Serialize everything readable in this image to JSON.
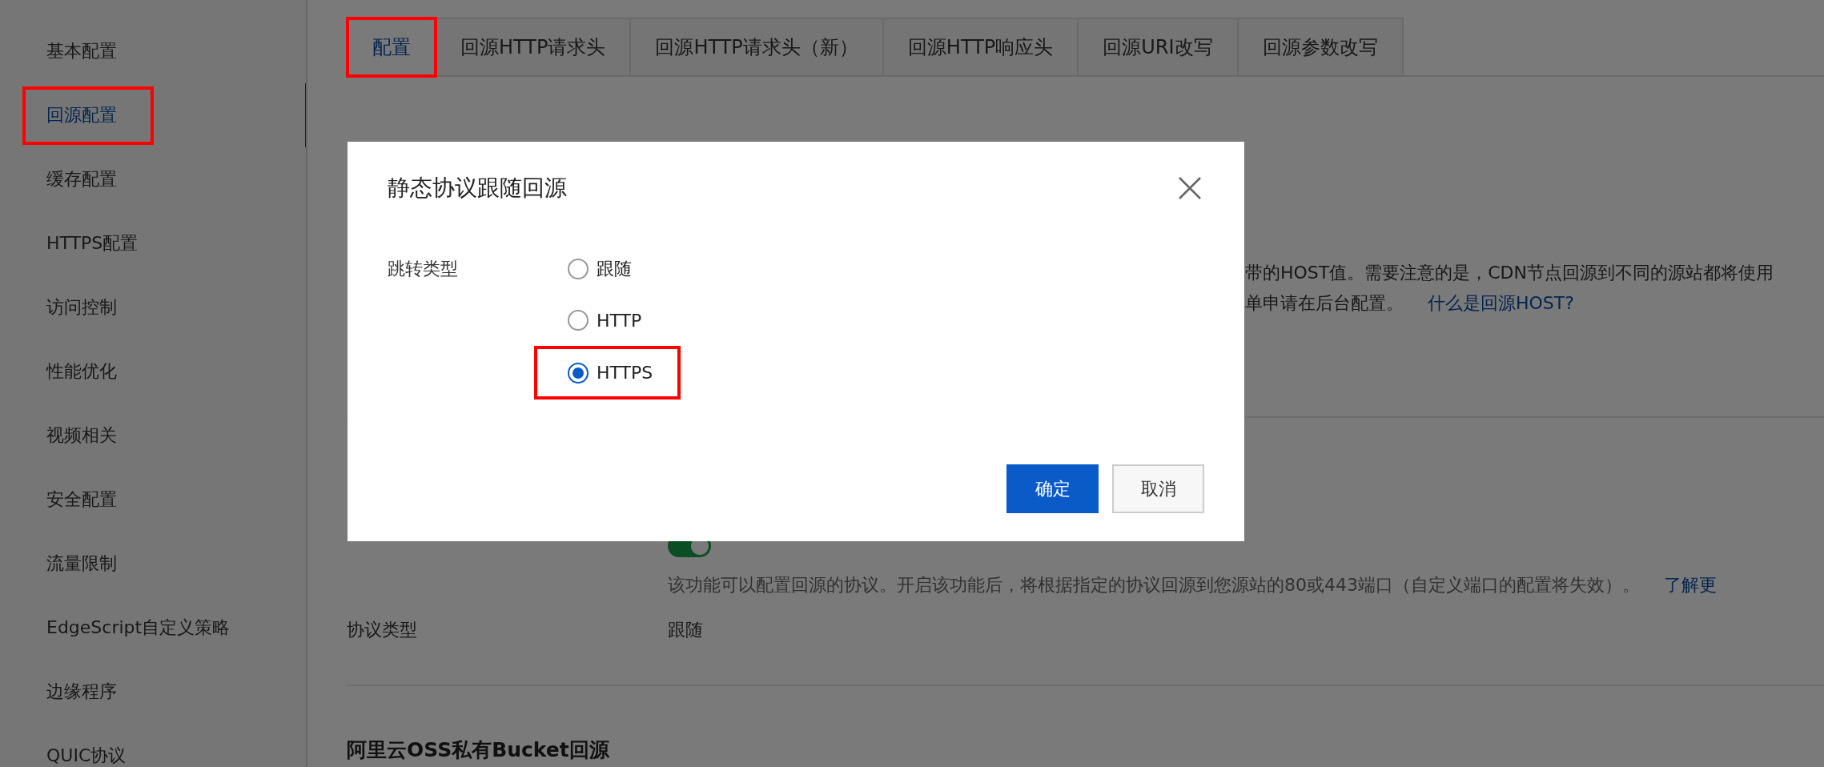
{
  "sidebar": {
    "items": [
      {
        "label": "基本配置",
        "selected": false,
        "highlighted": false
      },
      {
        "label": "回源配置",
        "selected": true,
        "highlighted": true
      },
      {
        "label": "缓存配置",
        "selected": false,
        "highlighted": false
      },
      {
        "label": "HTTPS配置",
        "selected": false,
        "highlighted": false
      },
      {
        "label": "访问控制",
        "selected": false,
        "highlighted": false
      },
      {
        "label": "性能优化",
        "selected": false,
        "highlighted": false
      },
      {
        "label": "视频相关",
        "selected": false,
        "highlighted": false
      },
      {
        "label": "安全配置",
        "selected": false,
        "highlighted": false
      },
      {
        "label": "流量限制",
        "selected": false,
        "highlighted": false
      },
      {
        "label": "EdgeScript自定义策略",
        "selected": false,
        "highlighted": false
      },
      {
        "label": "边缘程序",
        "selected": false,
        "highlighted": false
      },
      {
        "label": "QUIC协议",
        "selected": false,
        "highlighted": false
      }
    ]
  },
  "tabs": [
    {
      "label": "配置",
      "selected": true,
      "highlighted": true
    },
    {
      "label": "回源HTTP请求头",
      "selected": false,
      "highlighted": false
    },
    {
      "label": "回源HTTP请求头（新）",
      "selected": false,
      "highlighted": false
    },
    {
      "label": "回源HTTP响应头",
      "selected": false,
      "highlighted": false
    },
    {
      "label": "回源URI改写",
      "selected": false,
      "highlighted": false
    },
    {
      "label": "回源参数改写",
      "selected": false,
      "highlighted": false
    }
  ],
  "host_section": {
    "description_lines": [
      "带的HOST值。需要注意的是，CDN节点回源到不同的源站都将使用",
      "单申请在后台配置。"
    ],
    "help_link": "什么是回源HOST?"
  },
  "protocol_section": {
    "toggle_on": true,
    "description": "该功能可以配置回源的协议。开启该功能后，将根据指定的协议回源到您源站的80或443端口（自定义端口的配置将失效）。",
    "learn_more": "了解更",
    "type_label": "协议类型",
    "type_value": "跟随"
  },
  "oss_section": {
    "title": "阿里云OSS私有Bucket回源"
  },
  "dialog": {
    "title": "静态协议跟随回源",
    "field_label": "跳转类型",
    "options": [
      {
        "label": "跟随",
        "selected": false,
        "highlighted": false
      },
      {
        "label": "HTTP",
        "selected": false,
        "highlighted": false
      },
      {
        "label": "HTTPS",
        "selected": true,
        "highlighted": true
      }
    ],
    "buttons": [
      {
        "label": "确定",
        "kind": "primary"
      },
      {
        "label": "取消",
        "kind": "secondary"
      }
    ]
  }
}
